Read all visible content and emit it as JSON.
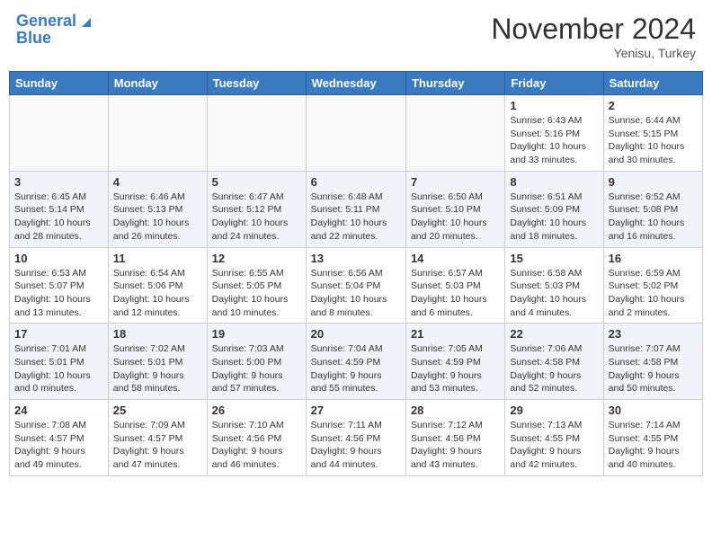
{
  "header": {
    "logo_line1": "General",
    "logo_line2": "Blue",
    "month": "November 2024",
    "location": "Yenisu, Turkey"
  },
  "days_of_week": [
    "Sunday",
    "Monday",
    "Tuesday",
    "Wednesday",
    "Thursday",
    "Friday",
    "Saturday"
  ],
  "weeks": [
    {
      "shaded": false,
      "days": [
        {
          "date": "",
          "info": ""
        },
        {
          "date": "",
          "info": ""
        },
        {
          "date": "",
          "info": ""
        },
        {
          "date": "",
          "info": ""
        },
        {
          "date": "",
          "info": ""
        },
        {
          "date": "1",
          "info": "Sunrise: 6:43 AM\nSunset: 5:16 PM\nDaylight: 10 hours\nand 33 minutes."
        },
        {
          "date": "2",
          "info": "Sunrise: 6:44 AM\nSunset: 5:15 PM\nDaylight: 10 hours\nand 30 minutes."
        }
      ]
    },
    {
      "shaded": true,
      "days": [
        {
          "date": "3",
          "info": "Sunrise: 6:45 AM\nSunset: 5:14 PM\nDaylight: 10 hours\nand 28 minutes."
        },
        {
          "date": "4",
          "info": "Sunrise: 6:46 AM\nSunset: 5:13 PM\nDaylight: 10 hours\nand 26 minutes."
        },
        {
          "date": "5",
          "info": "Sunrise: 6:47 AM\nSunset: 5:12 PM\nDaylight: 10 hours\nand 24 minutes."
        },
        {
          "date": "6",
          "info": "Sunrise: 6:48 AM\nSunset: 5:11 PM\nDaylight: 10 hours\nand 22 minutes."
        },
        {
          "date": "7",
          "info": "Sunrise: 6:50 AM\nSunset: 5:10 PM\nDaylight: 10 hours\nand 20 minutes."
        },
        {
          "date": "8",
          "info": "Sunrise: 6:51 AM\nSunset: 5:09 PM\nDaylight: 10 hours\nand 18 minutes."
        },
        {
          "date": "9",
          "info": "Sunrise: 6:52 AM\nSunset: 5:08 PM\nDaylight: 10 hours\nand 16 minutes."
        }
      ]
    },
    {
      "shaded": false,
      "days": [
        {
          "date": "10",
          "info": "Sunrise: 6:53 AM\nSunset: 5:07 PM\nDaylight: 10 hours\nand 13 minutes."
        },
        {
          "date": "11",
          "info": "Sunrise: 6:54 AM\nSunset: 5:06 PM\nDaylight: 10 hours\nand 12 minutes."
        },
        {
          "date": "12",
          "info": "Sunrise: 6:55 AM\nSunset: 5:05 PM\nDaylight: 10 hours\nand 10 minutes."
        },
        {
          "date": "13",
          "info": "Sunrise: 6:56 AM\nSunset: 5:04 PM\nDaylight: 10 hours\nand 8 minutes."
        },
        {
          "date": "14",
          "info": "Sunrise: 6:57 AM\nSunset: 5:03 PM\nDaylight: 10 hours\nand 6 minutes."
        },
        {
          "date": "15",
          "info": "Sunrise: 6:58 AM\nSunset: 5:03 PM\nDaylight: 10 hours\nand 4 minutes."
        },
        {
          "date": "16",
          "info": "Sunrise: 6:59 AM\nSunset: 5:02 PM\nDaylight: 10 hours\nand 2 minutes."
        }
      ]
    },
    {
      "shaded": true,
      "days": [
        {
          "date": "17",
          "info": "Sunrise: 7:01 AM\nSunset: 5:01 PM\nDaylight: 10 hours\nand 0 minutes."
        },
        {
          "date": "18",
          "info": "Sunrise: 7:02 AM\nSunset: 5:01 PM\nDaylight: 9 hours\nand 58 minutes."
        },
        {
          "date": "19",
          "info": "Sunrise: 7:03 AM\nSunset: 5:00 PM\nDaylight: 9 hours\nand 57 minutes."
        },
        {
          "date": "20",
          "info": "Sunrise: 7:04 AM\nSunset: 4:59 PM\nDaylight: 9 hours\nand 55 minutes."
        },
        {
          "date": "21",
          "info": "Sunrise: 7:05 AM\nSunset: 4:59 PM\nDaylight: 9 hours\nand 53 minutes."
        },
        {
          "date": "22",
          "info": "Sunrise: 7:06 AM\nSunset: 4:58 PM\nDaylight: 9 hours\nand 52 minutes."
        },
        {
          "date": "23",
          "info": "Sunrise: 7:07 AM\nSunset: 4:58 PM\nDaylight: 9 hours\nand 50 minutes."
        }
      ]
    },
    {
      "shaded": false,
      "days": [
        {
          "date": "24",
          "info": "Sunrise: 7:08 AM\nSunset: 4:57 PM\nDaylight: 9 hours\nand 49 minutes."
        },
        {
          "date": "25",
          "info": "Sunrise: 7:09 AM\nSunset: 4:57 PM\nDaylight: 9 hours\nand 47 minutes."
        },
        {
          "date": "26",
          "info": "Sunrise: 7:10 AM\nSunset: 4:56 PM\nDaylight: 9 hours\nand 46 minutes."
        },
        {
          "date": "27",
          "info": "Sunrise: 7:11 AM\nSunset: 4:56 PM\nDaylight: 9 hours\nand 44 minutes."
        },
        {
          "date": "28",
          "info": "Sunrise: 7:12 AM\nSunset: 4:56 PM\nDaylight: 9 hours\nand 43 minutes."
        },
        {
          "date": "29",
          "info": "Sunrise: 7:13 AM\nSunset: 4:55 PM\nDaylight: 9 hours\nand 42 minutes."
        },
        {
          "date": "30",
          "info": "Sunrise: 7:14 AM\nSunset: 4:55 PM\nDaylight: 9 hours\nand 40 minutes."
        }
      ]
    }
  ]
}
